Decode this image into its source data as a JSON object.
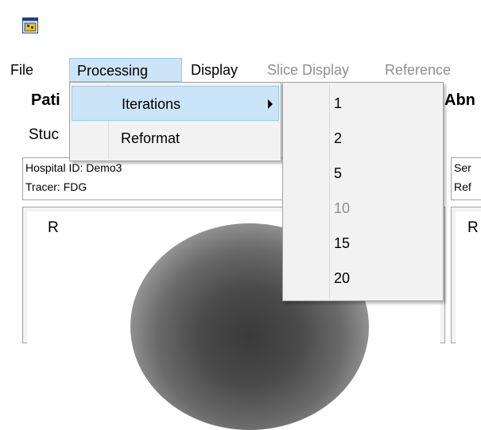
{
  "window": {
    "icon": "app-window-icon"
  },
  "menubar": {
    "items": [
      {
        "label": "File"
      },
      {
        "label": "Processing"
      },
      {
        "label": "Display"
      },
      {
        "label": "Slice Display"
      },
      {
        "label": "Reference"
      }
    ]
  },
  "labels": {
    "patient_partial": "Pati",
    "study_partial": "Stuc",
    "abnormal_partial": "Abn"
  },
  "info_left": {
    "hospital_id": "Hospital ID: Demo3",
    "tracer": "Tracer: FDG"
  },
  "info_right": {
    "line1_partial": "Ser",
    "line2_partial": "Ref"
  },
  "views": {
    "left_orientation": "R",
    "right_orientation": "R"
  },
  "processing_menu": {
    "items": [
      {
        "label": "Iterations",
        "has_submenu": true
      },
      {
        "label": "Reformat",
        "has_submenu": false
      }
    ]
  },
  "iterations_submenu": {
    "items": [
      {
        "label": "1",
        "enabled": true
      },
      {
        "label": "2",
        "enabled": true
      },
      {
        "label": "5",
        "enabled": true
      },
      {
        "label": "10",
        "enabled": false
      },
      {
        "label": "15",
        "enabled": true
      },
      {
        "label": "20",
        "enabled": true
      }
    ]
  },
  "colors": {
    "highlight": "#cce4f7",
    "highlight_border": "#99c9ef",
    "disabled_text": "#8f8f8f",
    "menu_bg": "#f2f2f2"
  }
}
